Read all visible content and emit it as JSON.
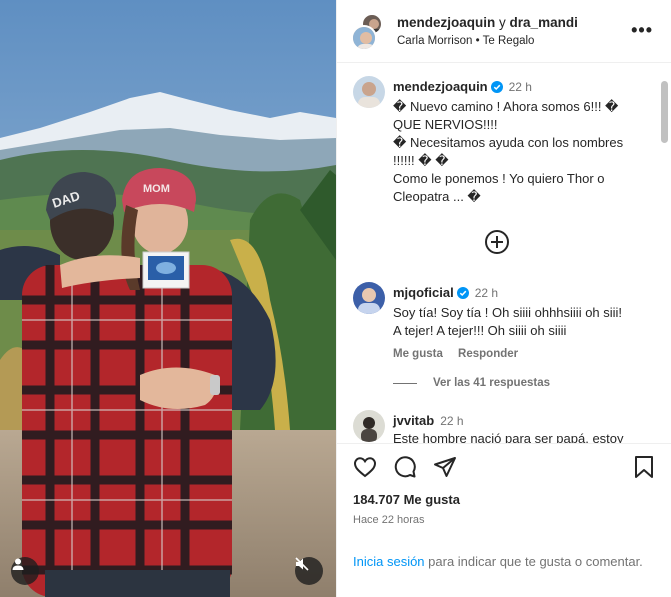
{
  "header": {
    "user1": "mendezjoaquin",
    "conj": "y",
    "user2": "dra_mandi",
    "artist": "Carla Morrison",
    "sep": "•",
    "song": "Te Regalo",
    "more": "•••"
  },
  "caption": {
    "username": "mendezjoaquin",
    "time": "22 h",
    "lines": [
      "� Nuevo camino ! Ahora somos 6!!! �",
      "QUE NERVIOS!!!!",
      "� Necesitamos ayuda con los nombres",
      "!!!!!! � �",
      "Como le ponemos ! Yo quiero Thor o",
      "Cleopatra ... �"
    ]
  },
  "comments": [
    {
      "username": "mjqoficial",
      "verified": true,
      "time": "22 h",
      "lines": [
        "Soy tía! Soy tía ! Oh siiii ohhhsiiii oh siii!",
        "A tejer! A tejer!!! Oh siiii oh siiii"
      ],
      "like_label": "Me gusta",
      "reply_label": "Responder",
      "view_replies": "Ver las 41 respuestas"
    },
    {
      "username": "jvvitab",
      "verified": false,
      "time": "22 h",
      "lines": [
        "Este hombre nació para ser papá, estoy"
      ]
    }
  ],
  "post": {
    "likes": "184.707 Me gusta",
    "ago": "Hace 22 horas",
    "login_link": "Inicia sesión",
    "login_rest": " para indicar que te gusta o comentar."
  },
  "media": {
    "cap_dad_text": "DAD",
    "cap_mom_text": "MOM"
  },
  "colors": {
    "link": "#0095f6",
    "verified": "#0095f6",
    "muted": "#737373"
  }
}
